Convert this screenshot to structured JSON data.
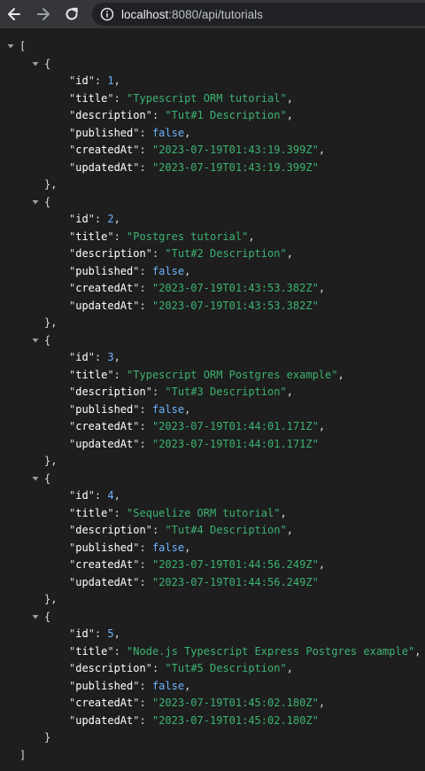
{
  "browser": {
    "url_host": "localhost",
    "url_rest": ":8080/api/tutorials"
  },
  "json_text": {
    "open_bracket": "[",
    "close_bracket": "]",
    "open_brace": "{",
    "close_brace": "}"
  },
  "records": [
    {
      "id": "1",
      "title": "Typescript ORM tutorial",
      "description": "Tut#1 Description",
      "published": "false",
      "createdAt": "2023-07-19T01:43:19.399Z",
      "updatedAt": "2023-07-19T01:43:19.399Z"
    },
    {
      "id": "2",
      "title": "Postgres tutorial",
      "description": "Tut#2 Description",
      "published": "false",
      "createdAt": "2023-07-19T01:43:53.382Z",
      "updatedAt": "2023-07-19T01:43:53.382Z"
    },
    {
      "id": "3",
      "title": "Typescript ORM Postgres example",
      "description": "Tut#3 Description",
      "published": "false",
      "createdAt": "2023-07-19T01:44:01.171Z",
      "updatedAt": "2023-07-19T01:44:01.171Z"
    },
    {
      "id": "4",
      "title": "Sequelize ORM tutorial",
      "description": "Tut#4 Description",
      "published": "false",
      "createdAt": "2023-07-19T01:44:56.249Z",
      "updatedAt": "2023-07-19T01:44:56.249Z"
    },
    {
      "id": "5",
      "title": "Node.js Typescript Express Postgres example",
      "description": "Tut#5 Description",
      "published": "false",
      "createdAt": "2023-07-19T01:45:02.180Z",
      "updatedAt": "2023-07-19T01:45:02.180Z"
    }
  ],
  "field_keys": [
    "id",
    "title",
    "description",
    "published",
    "createdAt",
    "updatedAt"
  ],
  "colors": {
    "key": "#ffffff",
    "string": "#3cb371",
    "number": "#6fb3ff",
    "boolean": "#6fb3ff"
  },
  "icons": {
    "back": "arrow-left-icon",
    "forward": "arrow-right-icon",
    "reload": "reload-icon",
    "info": "info-icon",
    "toggle": "caret-down-icon"
  }
}
